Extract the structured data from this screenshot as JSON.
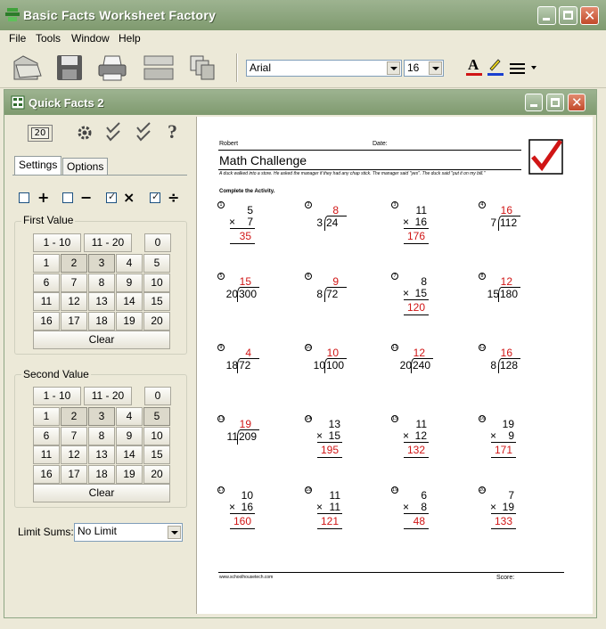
{
  "app": {
    "title": "Basic Facts Worksheet Factory"
  },
  "menu": [
    "File",
    "Tools",
    "Window",
    "Help"
  ],
  "toolbar": {
    "icons": [
      "open-icon",
      "save-icon",
      "print-icon",
      "preview-icon",
      "pages-icon"
    ],
    "font_name": "Arial",
    "font_size": "16",
    "text_color": "#d01515",
    "highlight_color": "#1a3fd0"
  },
  "child": {
    "title": "Quick Facts 2"
  },
  "left": {
    "count": "20",
    "tabs": [
      "Settings",
      "Options"
    ],
    "operations": [
      {
        "symbol": "+",
        "checked": false
      },
      {
        "symbol": "−",
        "checked": false
      },
      {
        "symbol": "×",
        "checked": true
      },
      {
        "symbol": "÷",
        "checked": true
      }
    ],
    "first_value": {
      "label": "First Value",
      "ranges": [
        "1 - 10",
        "11 - 20",
        "0"
      ],
      "grid": [
        "1",
        "2",
        "3",
        "4",
        "5",
        "6",
        "7",
        "8",
        "9",
        "10",
        "11",
        "12",
        "13",
        "14",
        "15",
        "16",
        "17",
        "18",
        "19",
        "20"
      ],
      "pressed": [
        "2",
        "3"
      ],
      "clear": "Clear"
    },
    "second_value": {
      "label": "Second Value",
      "ranges": [
        "1 - 10",
        "11 - 20",
        "0"
      ],
      "grid": [
        "1",
        "2",
        "3",
        "4",
        "5",
        "6",
        "7",
        "8",
        "9",
        "10",
        "11",
        "12",
        "13",
        "14",
        "15",
        "16",
        "17",
        "18",
        "19",
        "20"
      ],
      "pressed": [
        "2",
        "3",
        "5"
      ],
      "clear": "Clear"
    },
    "limit_sums": {
      "label": "Limit Sums:",
      "value": "No Limit"
    }
  },
  "worksheet": {
    "name": "Robert",
    "date_label": "Date:",
    "title": "Math Challenge",
    "story": "A duck walked into a store. He asked the manager if they had any chap stick. The manager said \"yes\". The duck said \"put it on my bill.\"",
    "instructions": "Complete the Activity.",
    "footer_url": "www.schoolhousetech.com",
    "score_label": "Score:",
    "problems": [
      {
        "n": "1",
        "type": "mul",
        "a": "5",
        "b": "7",
        "ans": "35"
      },
      {
        "n": "2",
        "type": "div",
        "divisor": "3",
        "dividend": "24",
        "ans": "8"
      },
      {
        "n": "3",
        "type": "mul",
        "a": "11",
        "b": "16",
        "ans": "176"
      },
      {
        "n": "4",
        "type": "div",
        "divisor": "7",
        "dividend": "112",
        "ans": "16"
      },
      {
        "n": "5",
        "type": "div",
        "divisor": "20",
        "dividend": "300",
        "ans": "15"
      },
      {
        "n": "6",
        "type": "div",
        "divisor": "8",
        "dividend": "72",
        "ans": "9"
      },
      {
        "n": "7",
        "type": "mul",
        "a": "8",
        "b": "15",
        "ans": "120"
      },
      {
        "n": "8",
        "type": "div",
        "divisor": "15",
        "dividend": "180",
        "ans": "12"
      },
      {
        "n": "9",
        "type": "div",
        "divisor": "18",
        "dividend": "72",
        "ans": "4"
      },
      {
        "n": "10",
        "type": "div",
        "divisor": "10",
        "dividend": "100",
        "ans": "10"
      },
      {
        "n": "11",
        "type": "div",
        "divisor": "20",
        "dividend": "240",
        "ans": "12"
      },
      {
        "n": "12",
        "type": "div",
        "divisor": "8",
        "dividend": "128",
        "ans": "16"
      },
      {
        "n": "13",
        "type": "div",
        "divisor": "11",
        "dividend": "209",
        "ans": "19"
      },
      {
        "n": "14",
        "type": "mul",
        "a": "13",
        "b": "15",
        "ans": "195"
      },
      {
        "n": "15",
        "type": "mul",
        "a": "11",
        "b": "12",
        "ans": "132"
      },
      {
        "n": "16",
        "type": "mul",
        "a": "19",
        "b": "9",
        "ans": "171"
      },
      {
        "n": "17",
        "type": "mul",
        "a": "10",
        "b": "16",
        "ans": "160"
      },
      {
        "n": "18",
        "type": "mul",
        "a": "11",
        "b": "11",
        "ans": "121"
      },
      {
        "n": "19",
        "type": "mul",
        "a": "6",
        "b": "8",
        "ans": "48"
      },
      {
        "n": "20",
        "type": "mul",
        "a": "7",
        "b": "19",
        "ans": "133"
      }
    ]
  }
}
